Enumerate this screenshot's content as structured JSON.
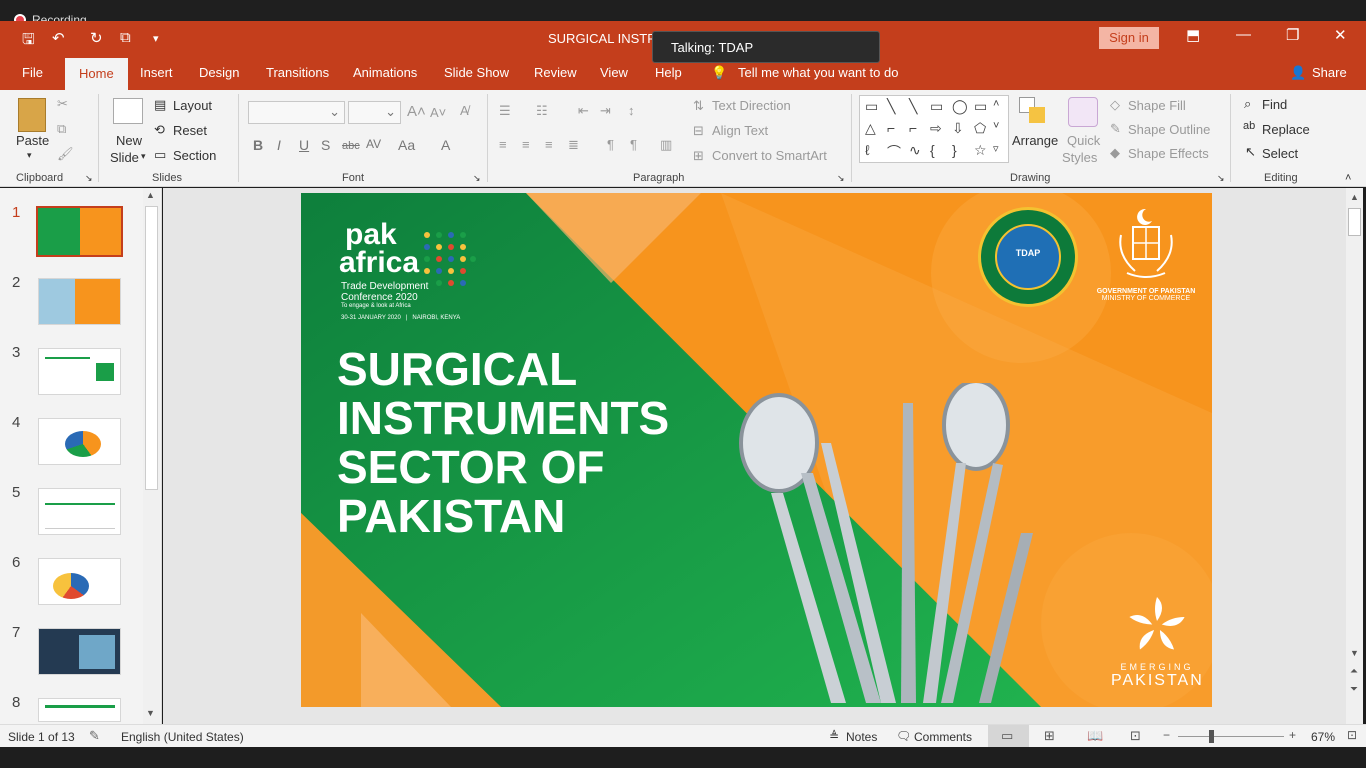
{
  "recording": {
    "label": "Recording"
  },
  "talking": {
    "label": "Talking: TDAP"
  },
  "window": {
    "title": "SURGICAL INSTRU",
    "sign_in": "Sign in"
  },
  "tabs": [
    {
      "label": "File"
    },
    {
      "label": "Home"
    },
    {
      "label": "Insert"
    },
    {
      "label": "Design"
    },
    {
      "label": "Transitions"
    },
    {
      "label": "Animations"
    },
    {
      "label": "Slide Show"
    },
    {
      "label": "Review"
    },
    {
      "label": "View"
    },
    {
      "label": "Help"
    }
  ],
  "tell_me": "Tell me what you want to do",
  "share": "Share",
  "ribbon": {
    "clipboard": {
      "label": "Clipboard",
      "paste": "Paste"
    },
    "slides": {
      "label": "Slides",
      "new_slide": "New",
      "new_slide2": "Slide",
      "layout": "Layout",
      "reset": "Reset",
      "section": "Section"
    },
    "font": {
      "label": "Font"
    },
    "paragraph": {
      "label": "Paragraph",
      "text_direction": "Text Direction",
      "align_text": "Align Text",
      "convert_smartart": "Convert to SmartArt"
    },
    "drawing": {
      "label": "Drawing",
      "arrange": "Arrange",
      "quick_styles": "Quick",
      "quick_styles2": "Styles",
      "shape_fill": "Shape Fill",
      "shape_outline": "Shape Outline",
      "shape_effects": "Shape Effects"
    },
    "editing": {
      "label": "Editing",
      "find": "Find",
      "replace": "Replace",
      "select": "Select"
    }
  },
  "thumbnails": [
    {
      "num": "1"
    },
    {
      "num": "2"
    },
    {
      "num": "3"
    },
    {
      "num": "4"
    },
    {
      "num": "5"
    },
    {
      "num": "6"
    },
    {
      "num": "7"
    },
    {
      "num": "8"
    }
  ],
  "slide": {
    "title": "SURGICAL\nINSTRUMENTS\nSECTOR OF\nPAKISTAN",
    "logo_pak": "pak",
    "logo_africa": "africa",
    "conf_line1": "Trade Development",
    "conf_line2": "Conference 2020",
    "conf_line3": "To engage & look at Africa",
    "conf_date": "30-31 JANUARY 2020   |   NAIROBI, KENYA",
    "tdap_seal": "TRADE DEVELOPMENT AUTHORITY OF PAKISTAN",
    "tdap_abbr": "TDAP",
    "gov_line1": "GOVERNMENT OF PAKISTAN",
    "gov_line2": "MINISTRY OF COMMERCE",
    "emerging": "EMERGING",
    "emerging2": "PAKISTAN"
  },
  "status": {
    "slide_count": "Slide 1 of 13",
    "language": "English (United States)",
    "notes": "Notes",
    "comments": "Comments",
    "zoom": "67%"
  },
  "colors": {
    "accent": "#c43e1c",
    "slide_green": "#1a9e48",
    "slide_orange": "#f7941d"
  }
}
